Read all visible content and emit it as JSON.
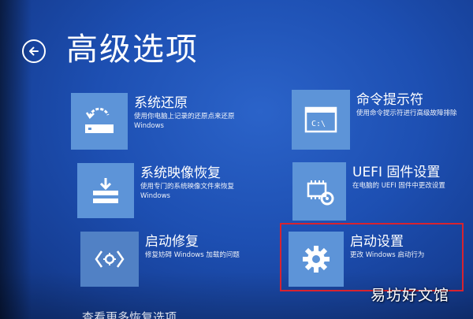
{
  "page": {
    "title": "高级选项",
    "back_icon": "back-arrow-icon"
  },
  "options": [
    {
      "id": "system-restore",
      "title": "系统还原",
      "desc1": "使用你电脑上记录的还原点来还原",
      "desc2": "Windows",
      "icon": "restore-icon"
    },
    {
      "id": "command-prompt",
      "title": "命令提示符",
      "desc1": "使用命令提示符进行高级故障排除",
      "desc2": "",
      "icon": "command-prompt-icon"
    },
    {
      "id": "system-image-recovery",
      "title": "系统映像恢复",
      "desc1": "使用专门的系统映像文件来恢复",
      "desc2": "Windows",
      "icon": "image-recovery-icon"
    },
    {
      "id": "uefi-firmware",
      "title": "UEFI 固件设置",
      "desc1": "在电脑的 UEFI 固件中更改设置",
      "desc2": "",
      "icon": "firmware-chip-icon"
    },
    {
      "id": "startup-repair",
      "title": "启动修复",
      "desc1": "修复妨碍 Windows 加载的问题",
      "desc2": "",
      "icon": "repair-brackets-icon"
    },
    {
      "id": "startup-settings",
      "title": "启动设置",
      "desc1": "更改 Windows 启动行为",
      "desc2": "",
      "icon": "gear-icon"
    }
  ],
  "footer": {
    "more_options": "查看更多恢复选项"
  },
  "watermark": "易坊好文馆",
  "colors": {
    "background": "#1d4fb2",
    "tile": "#5d94d8",
    "highlight": "#d8232f"
  }
}
